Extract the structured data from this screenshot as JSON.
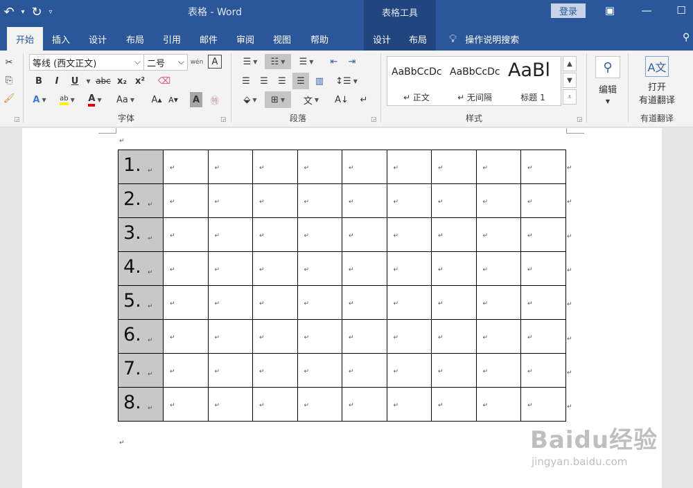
{
  "titlebar": {
    "doc_title": "表格 - Word",
    "context_title": "表格工具",
    "login_label": "登录"
  },
  "tabs": [
    "开始",
    "插入",
    "设计",
    "布局",
    "引用",
    "邮件",
    "审阅",
    "视图",
    "帮助"
  ],
  "context_tabs": [
    "设计",
    "布局"
  ],
  "tell_me": "操作说明搜索",
  "font": {
    "name": "等线 (西文正文)",
    "size": "二号",
    "group_label": "字体",
    "bold": "B",
    "italic": "I",
    "underline": "U",
    "strike": "abc",
    "subscript": "x₂",
    "superscript": "x²",
    "case": "Aa"
  },
  "paragraph": {
    "group_label": "段落"
  },
  "styles": {
    "group_label": "样式",
    "items": [
      {
        "preview": "AaBbCcDc",
        "name": "↵ 正文"
      },
      {
        "preview": "AaBbCcDc",
        "name": "↵ 无间隔"
      },
      {
        "preview": "AaBl",
        "name": "标题 1"
      }
    ]
  },
  "editing": {
    "label": "编辑"
  },
  "youdao": {
    "line1": "打开",
    "line2": "有道翻译",
    "group_label": "有道翻译"
  },
  "table": {
    "row_labels": [
      "1.",
      "2.",
      "3.",
      "4.",
      "5.",
      "6.",
      "7.",
      "8."
    ],
    "empty_columns": 9
  },
  "paragraph_mark": "↵",
  "watermark": {
    "brand": "Baidu经验",
    "url": "jingyan.baidu.com"
  }
}
